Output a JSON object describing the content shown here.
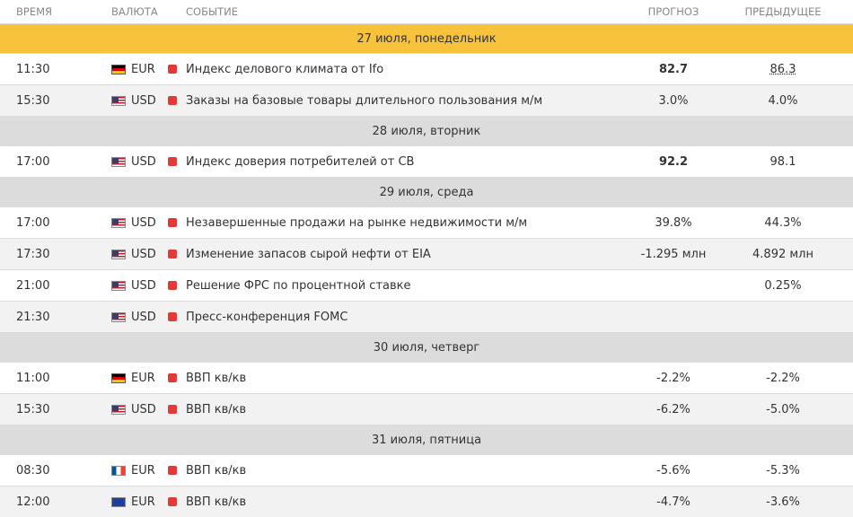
{
  "columns": {
    "time": "ВРЕМЯ",
    "currency": "ВАЛЮТА",
    "event": "СОБЫТИЕ",
    "forecast": "ПРОГНОЗ",
    "previous": "ПРЕДЫДУЩЕЕ"
  },
  "rows": [
    {
      "type": "day",
      "label": "27 июля, понедельник",
      "highlight": true
    },
    {
      "type": "event",
      "time": "11:30",
      "flag": "de-flag-icon",
      "currency": "EUR",
      "event": "Индекс делового климата от Ifo",
      "forecast": "82.7",
      "previous": "86.3",
      "forecast_bold": true,
      "previous_underlined": true
    },
    {
      "type": "event",
      "time": "15:30",
      "flag": "us-flag-icon",
      "currency": "USD",
      "event": "Заказы на базовые товары длительного пользования м/м",
      "forecast": "3.0%",
      "previous": "4.0%"
    },
    {
      "type": "day",
      "label": "28 июля, вторник"
    },
    {
      "type": "event",
      "time": "17:00",
      "flag": "us-flag-icon",
      "currency": "USD",
      "event": "Индекс доверия потребителей от CB",
      "forecast": "92.2",
      "previous": "98.1",
      "forecast_bold": true
    },
    {
      "type": "day",
      "label": "29 июля, среда"
    },
    {
      "type": "event",
      "time": "17:00",
      "flag": "us-flag-icon",
      "currency": "USD",
      "event": "Незавершенные продажи на рынке недвижимости м/м",
      "forecast": "39.8%",
      "previous": "44.3%"
    },
    {
      "type": "event",
      "time": "17:30",
      "flag": "us-flag-icon",
      "currency": "USD",
      "event": "Изменение запасов сырой нефти от EIA",
      "forecast": "-1.295 млн",
      "previous": "4.892 млн"
    },
    {
      "type": "event",
      "time": "21:00",
      "flag": "us-flag-icon",
      "currency": "USD",
      "event": "Решение ФРС по процентной ставке",
      "forecast": "",
      "previous": "0.25%"
    },
    {
      "type": "event",
      "time": "21:30",
      "flag": "us-flag-icon",
      "currency": "USD",
      "event": "Пресс-конференция FOMC",
      "forecast": "",
      "previous": ""
    },
    {
      "type": "day",
      "label": "30 июля, четверг"
    },
    {
      "type": "event",
      "time": "11:00",
      "flag": "de-flag-icon",
      "currency": "EUR",
      "event": "ВВП кв/кв",
      "forecast": "-2.2%",
      "previous": "-2.2%"
    },
    {
      "type": "event",
      "time": "15:30",
      "flag": "us-flag-icon",
      "currency": "USD",
      "event": "ВВП кв/кв",
      "forecast": "-6.2%",
      "previous": "-5.0%"
    },
    {
      "type": "day",
      "label": "31 июля, пятница"
    },
    {
      "type": "event",
      "time": "08:30",
      "flag": "fr-flag-icon",
      "currency": "EUR",
      "event": "ВВП кв/кв",
      "forecast": "-5.6%",
      "previous": "-5.3%"
    },
    {
      "type": "event",
      "time": "12:00",
      "flag": "eu-flag-icon",
      "currency": "EUR",
      "event": "ВВП кв/кв",
      "forecast": "-4.7%",
      "previous": "-3.6%"
    }
  ]
}
